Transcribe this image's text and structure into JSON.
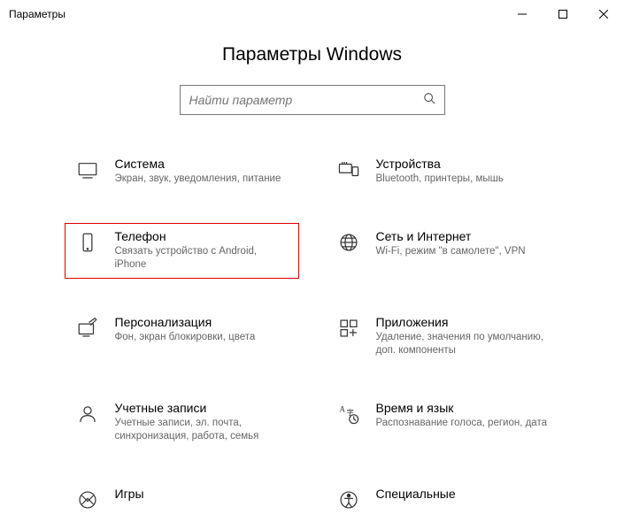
{
  "window": {
    "title": "Параметры"
  },
  "page": {
    "heading": "Параметры Windows"
  },
  "search": {
    "placeholder": "Найти параметр"
  },
  "tiles": [
    {
      "title": "Система",
      "desc": "Экран, звук, уведомления, питание"
    },
    {
      "title": "Устройства",
      "desc": "Bluetooth, принтеры, мышь"
    },
    {
      "title": "Телефон",
      "desc": "Связать устройство с Android, iPhone"
    },
    {
      "title": "Сеть и Интернет",
      "desc": "Wi-Fi, режим \"в самолете\", VPN"
    },
    {
      "title": "Персонализация",
      "desc": "Фон, экран блокировки, цвета"
    },
    {
      "title": "Приложения",
      "desc": "Удаление, значения по умолчанию, доп. компоненты"
    },
    {
      "title": "Учетные записи",
      "desc": "Учетные записи, эл. почта, синхронизация, работа, семья"
    },
    {
      "title": "Время и язык",
      "desc": "Распознавание голоса, регион, дата"
    },
    {
      "title": "Игры",
      "desc": ""
    },
    {
      "title": "Специальные",
      "desc": ""
    }
  ]
}
